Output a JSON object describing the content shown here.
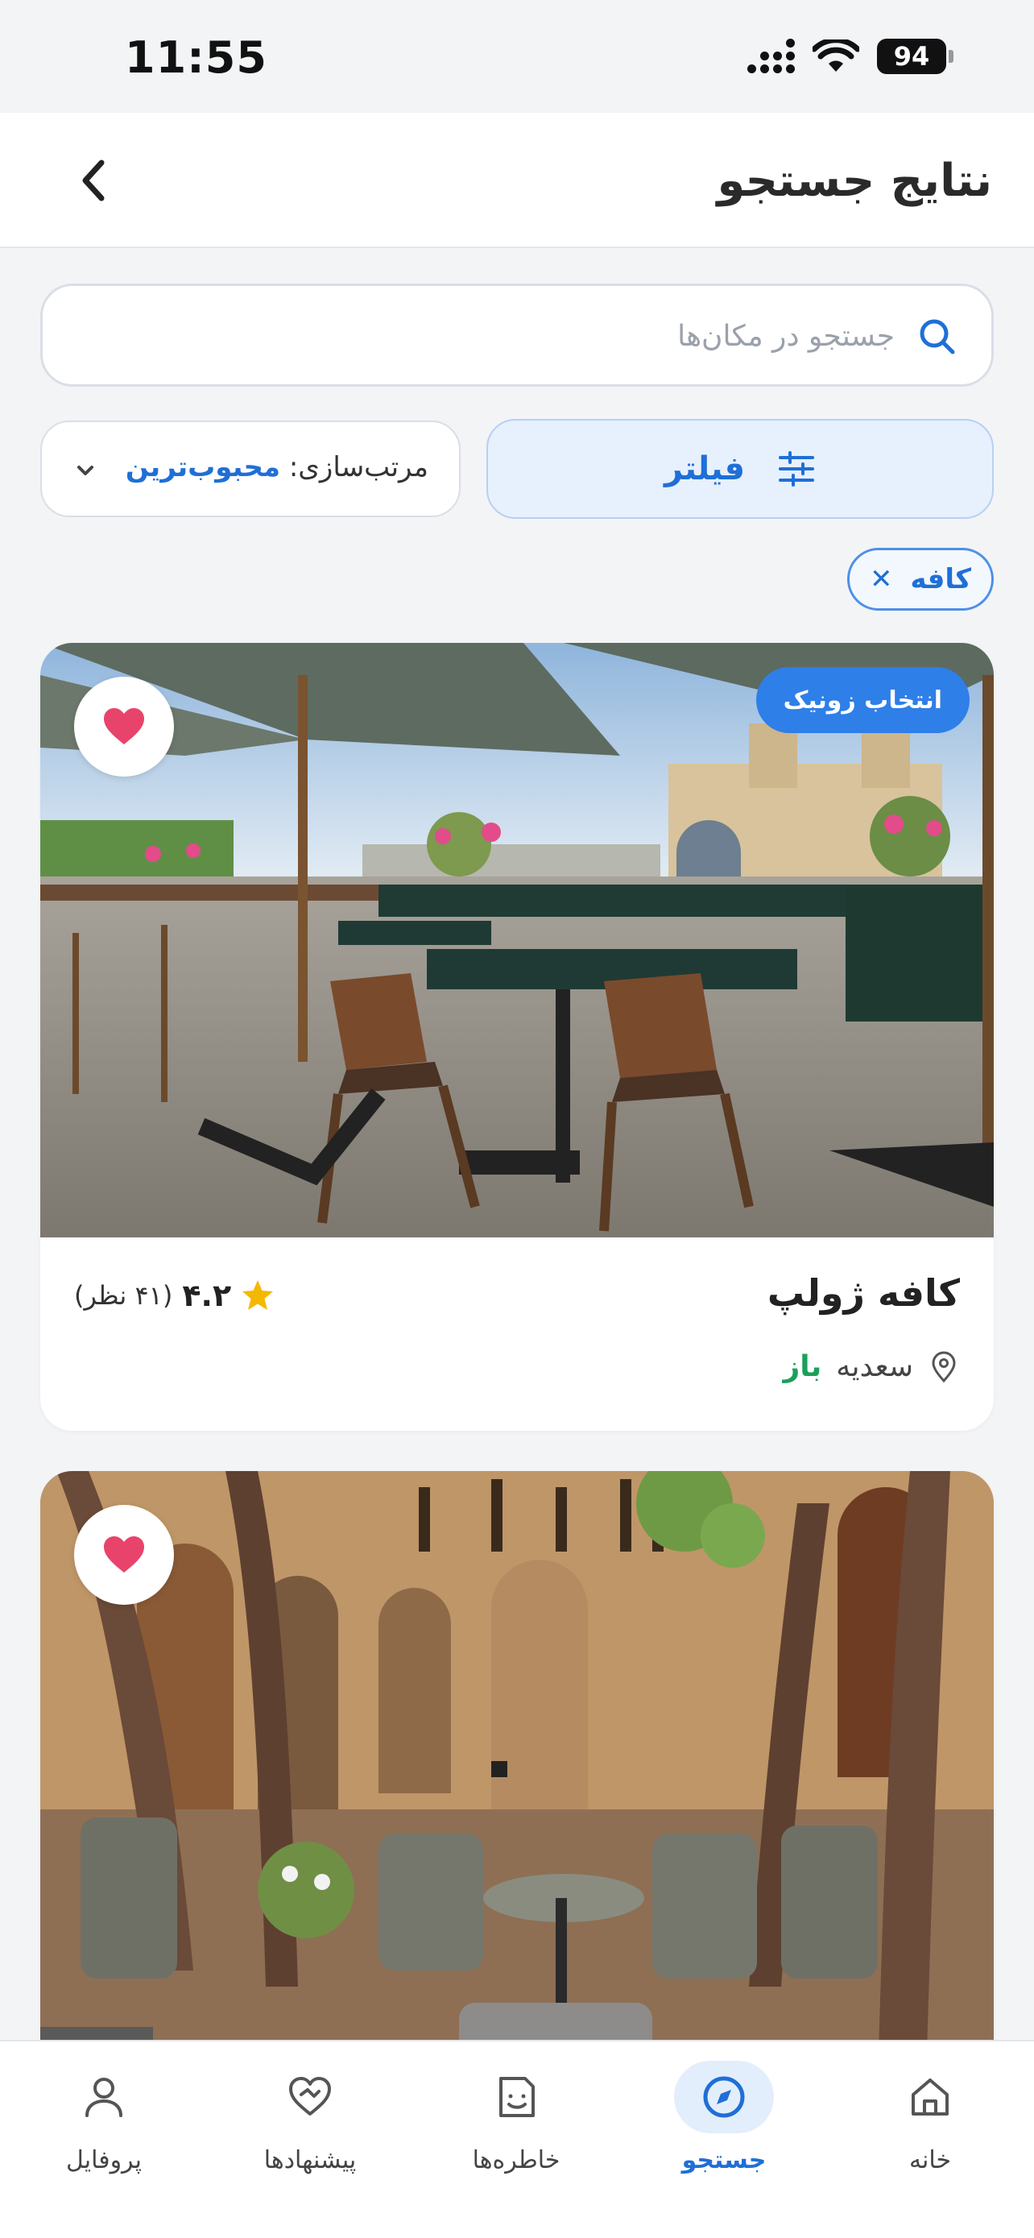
{
  "status_bar": {
    "time": "11:55",
    "battery": "94"
  },
  "header": {
    "title": "نتایج جستجو",
    "back_icon": "chevron-left-icon"
  },
  "search": {
    "placeholder": "جستجو در مکان‌ها",
    "value": ""
  },
  "sort": {
    "label": "مرتب‌سازی:",
    "value": "محبوب‌ترین"
  },
  "filter": {
    "label": "فیلتر"
  },
  "active_filters": [
    {
      "label": "کافه"
    }
  ],
  "colors": {
    "accent": "#1f6fd6",
    "open": "#1aa05a",
    "favorite": "#e8446b",
    "star": "#f5b800"
  },
  "results": [
    {
      "name": "کافه ژولپ",
      "badge": "انتخاب زونیک",
      "rating": "۴.۲",
      "reviews": "(۴۱ نظر)",
      "location": "سعدیه",
      "status": "باز",
      "favorite": true
    },
    {
      "name": "",
      "favorite": true
    }
  ],
  "bottom_nav": [
    {
      "label": "خانه",
      "icon": "home-icon",
      "active": false
    },
    {
      "label": "جستجو",
      "icon": "compass-icon",
      "active": true
    },
    {
      "label": "خاطره‌ها",
      "icon": "memories-icon",
      "active": false
    },
    {
      "label": "پیشنهادها",
      "icon": "heart-handshake-icon",
      "active": false
    },
    {
      "label": "پروفایل",
      "icon": "user-icon",
      "active": false
    }
  ]
}
